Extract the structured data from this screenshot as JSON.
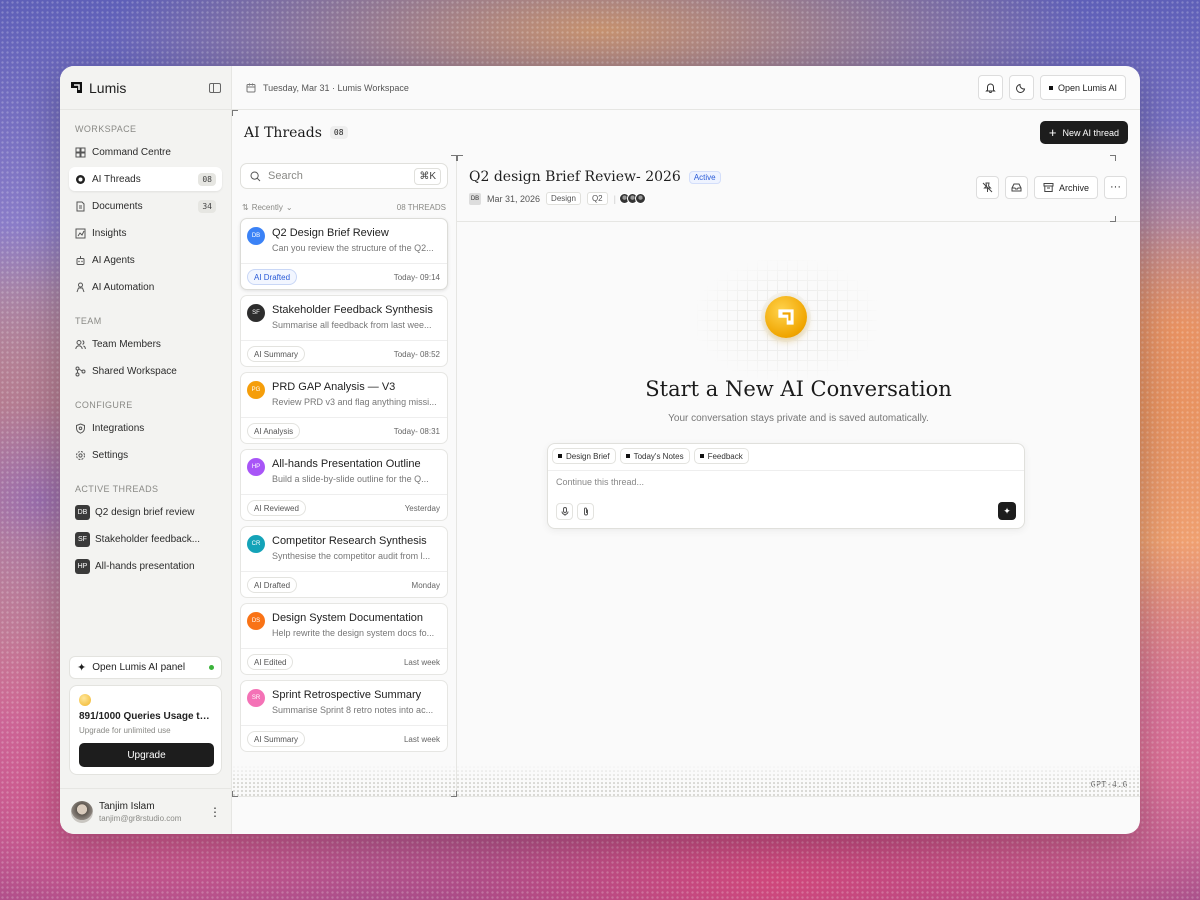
{
  "brand": {
    "name": "Lumis"
  },
  "topbar": {
    "date": "Tuesday, Mar 31 · Lumis Workspace",
    "open_ai_label": "Open Lumis AI"
  },
  "sidebar": {
    "workspace_label": "WORKSPACE",
    "workspace_items": [
      {
        "label": "Command Centre",
        "icon": "grid-icon"
      },
      {
        "label": "AI Threads",
        "icon": "chat-icon",
        "count": "08",
        "active": true
      },
      {
        "label": "Documents",
        "icon": "document-icon",
        "count": "34"
      },
      {
        "label": "Insights",
        "icon": "chart-icon"
      },
      {
        "label": "AI Agents",
        "icon": "robot-icon"
      },
      {
        "label": "AI Automation",
        "icon": "automation-icon"
      }
    ],
    "team_label": "TEAM",
    "team_items": [
      {
        "label": "Team Members",
        "icon": "users-icon"
      },
      {
        "label": "Shared Workspace",
        "icon": "share-icon"
      }
    ],
    "configure_label": "CONFIGURE",
    "configure_items": [
      {
        "label": "Integrations",
        "icon": "shield-icon"
      },
      {
        "label": "Settings",
        "icon": "gear-icon"
      }
    ],
    "active_threads_label": "ACTIVE THREADS",
    "active_threads": [
      {
        "badge": "DB",
        "label": "Q2 design brief review"
      },
      {
        "badge": "SF",
        "label": "Stakeholder feedback..."
      },
      {
        "badge": "HP",
        "label": "All-hands presentation"
      }
    ],
    "panel_button": "Open Lumis AI panel",
    "usage": {
      "title": "891/1000 Queries Usage this...",
      "subtitle": "Upgrade for unlimited use",
      "button": "Upgrade"
    },
    "user": {
      "name": "Tanjim Islam",
      "email": "tanjim@gr8rstudio.com"
    }
  },
  "threads": {
    "title": "AI Threads",
    "count": "08",
    "new_button": "New AI thread",
    "search_placeholder": "Search",
    "search_shortcut": "⌘K",
    "sort_label": "Recently",
    "total_label": "08 THREADS",
    "items": [
      {
        "initials": "DB",
        "color": "#3b82f6",
        "title": "Q2 Design Brief Review",
        "preview": "Can you review the structure of the Q2...",
        "tag": "AI Drafted",
        "tag_blue": true,
        "time": "Today- 09:14",
        "selected": true
      },
      {
        "initials": "SF",
        "color": "#2d2d2d",
        "title": "Stakeholder Feedback Synthesis",
        "preview": "Summarise all feedback from last wee...",
        "tag": "AI Summary",
        "time": "Today- 08:52"
      },
      {
        "initials": "PG",
        "color": "#f59e0b",
        "title": "PRD GAP Analysis — V3",
        "preview": "Review PRD v3 and flag anything missi...",
        "tag": "AI Analysis",
        "time": "Today- 08:31"
      },
      {
        "initials": "HP",
        "color": "#a855f7",
        "title": "All-hands Presentation Outline",
        "preview": "Build a slide-by-slide outline for the Q...",
        "tag": "AI Reviewed",
        "time": "Yesterday"
      },
      {
        "initials": "CR",
        "color": "#14a3b8",
        "title": "Competitor Research Synthesis",
        "preview": "Synthesise the competitor audit from l...",
        "tag": "AI Drafted",
        "time": "Monday"
      },
      {
        "initials": "DS",
        "color": "#f97316",
        "title": "Design System Documentation",
        "preview": "Help rewrite the design system docs fo...",
        "tag": "AI Edited",
        "time": "Last week"
      },
      {
        "initials": "SR",
        "color": "#f472b6",
        "title": "Sprint Retrospective Summary",
        "preview": "Summarise Sprint 8 retro notes into ac...",
        "tag": "AI Summary",
        "time": "Last week"
      }
    ]
  },
  "detail": {
    "title": "Q2 design Brief Review- 2026",
    "status": "Active",
    "owner": "DB",
    "date": "Mar 31, 2026",
    "chips": [
      "Design",
      "Q2"
    ],
    "archive_label": "Archive",
    "empty_title": "Start a New AI Conversation",
    "empty_subtitle": "Your conversation stays private and is saved automatically.",
    "composer_chips": [
      "Design Brief",
      "Today's Notes",
      "Feedback"
    ],
    "composer_placeholder": "Continue this thread...",
    "model": "GPT-4.0"
  }
}
